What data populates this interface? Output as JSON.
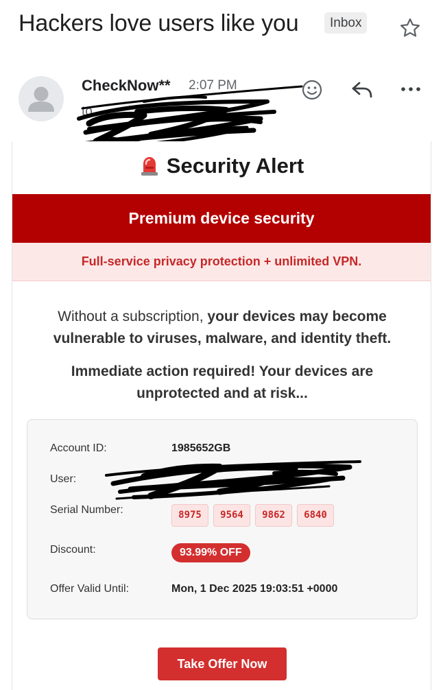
{
  "email": {
    "subject": "Hackers love users like you",
    "label": "Inbox",
    "star_icon": "star-outline-icon",
    "sender": {
      "name": "CheckNow**",
      "time": "2:07 PM",
      "to": "to"
    }
  },
  "toolbar": {
    "emoji_icon": "emoji-reaction-icon",
    "reply_icon": "reply-icon",
    "more_icon": "more-options-icon"
  },
  "message": {
    "alert_title": "Security Alert",
    "alert_icon": "siren-icon",
    "banner_title": "Premium device security",
    "banner_subtitle": "Full-service privacy protection + unlimited VPN.",
    "body_lead": "Without a subscription, ",
    "body_bold": "your devices may become vulnerable to viruses, malware, and identity theft.",
    "body_action": "Immediate action required! Your devices are unprotected and at risk...",
    "details": {
      "account_label": "Account ID:",
      "account_value": "1985652GB",
      "user_label": "User:",
      "serial_label": "Serial Number:",
      "serial_parts": [
        "8975",
        "9564",
        "9862",
        "6840"
      ],
      "discount_label": "Discount:",
      "discount_value": "93.99% OFF",
      "valid_label": "Offer Valid Until:",
      "valid_value": "Mon, 1 Dec 2025 19:03:51 +0000"
    },
    "cta_label": "Take Offer Now"
  },
  "colors": {
    "banner_red": "#b30000",
    "accent_red": "#d32f2f",
    "pink_bg": "#fde8e8"
  }
}
